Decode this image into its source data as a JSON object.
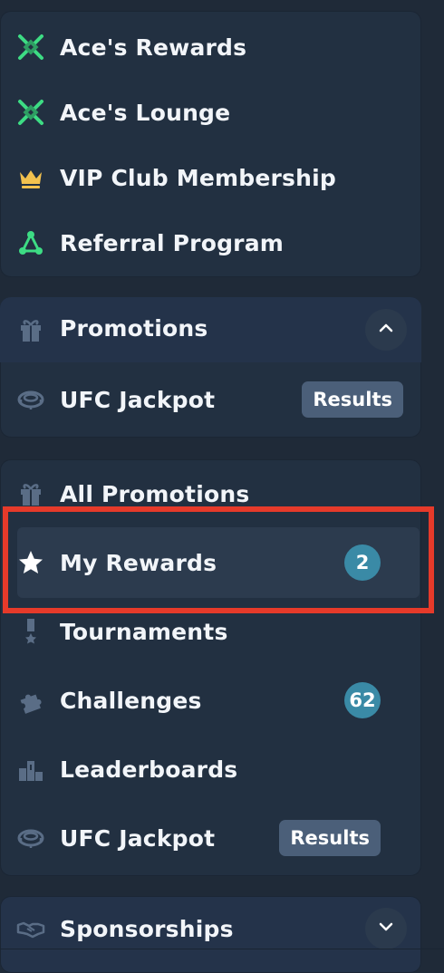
{
  "top_menu": {
    "items": [
      {
        "label": "Ace's Rewards",
        "icon": "ace-shield-icon"
      },
      {
        "label": "Ace's Lounge",
        "icon": "ace-shield-icon"
      },
      {
        "label": "VIP Club Membership",
        "icon": "crown-icon"
      },
      {
        "label": "Referral Program",
        "icon": "referral-network-icon"
      }
    ]
  },
  "promotions_section": {
    "title": "Promotions",
    "expanded": true,
    "items": [
      {
        "label": "UFC Jackpot",
        "button": "Results",
        "icon": "octagon-icon"
      }
    ]
  },
  "promotions_list": {
    "items": [
      {
        "label": "All Promotions",
        "icon": "gift-icon"
      },
      {
        "label": "My Rewards",
        "icon": "star-icon",
        "badge": "2",
        "selected": true
      },
      {
        "label": "Tournaments",
        "icon": "medal-icon"
      },
      {
        "label": "Challenges",
        "icon": "puzzle-icon",
        "badge": "62"
      },
      {
        "label": "Leaderboards",
        "icon": "podium-icon"
      },
      {
        "label": "UFC Jackpot",
        "icon": "octagon-icon",
        "button": "Results"
      }
    ]
  },
  "sponsorships_section": {
    "title": "Sponsorships",
    "expanded": false,
    "icon": "handshake-icon"
  },
  "colors": {
    "background": "#1f2a38",
    "card": "#223041",
    "accent_green": "#3ddc84",
    "crown_gold": "#f2c14e",
    "badge_teal": "#3a8aa6",
    "highlight_red": "#e63a2a"
  }
}
